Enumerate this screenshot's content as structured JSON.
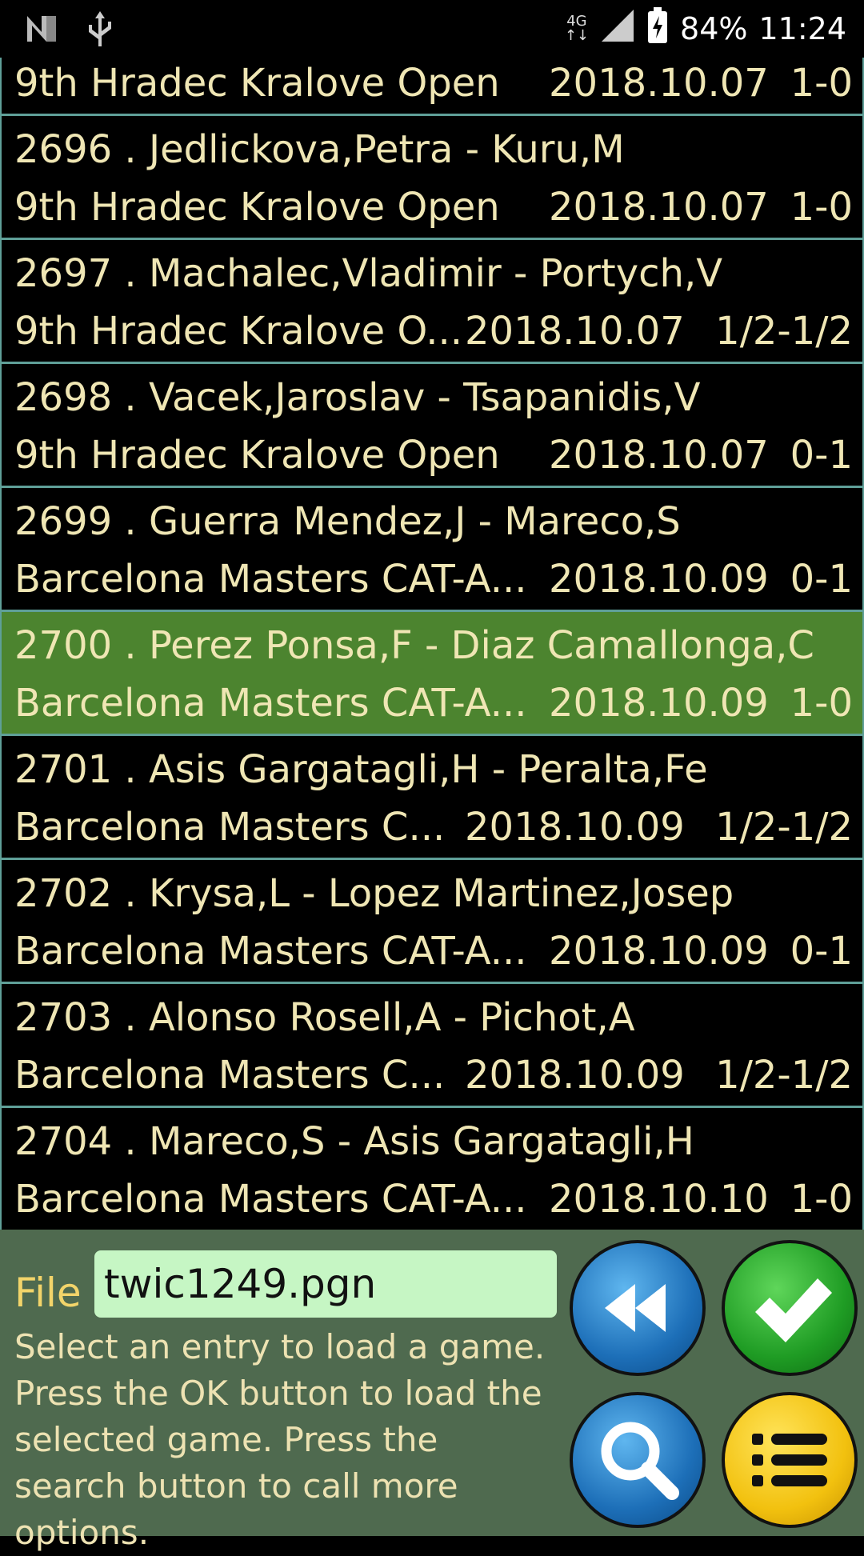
{
  "status_bar": {
    "network": "4G",
    "battery": "84%",
    "time": "11:24"
  },
  "games": [
    {
      "number": "",
      "white": "",
      "black": "",
      "event": "9th Hradec Kralove Open",
      "date": "2018.10.07",
      "result": "1-0"
    },
    {
      "number": "2696 .",
      "white": "Jedlickova,Petra",
      "black": "- Kuru,M",
      "event": "9th Hradec Kralove Open",
      "date": "2018.10.07",
      "result": "1-0"
    },
    {
      "number": "2697 .",
      "white": "Machalec,Vladimir",
      "black": "- Portych,V",
      "event": "9th Hradec Kralove O...",
      "date": "2018.10.07",
      "result": "1/2-1/2"
    },
    {
      "number": "2698 .",
      "white": "Vacek,Jaroslav",
      "black": "- Tsapanidis,V",
      "event": "9th Hradec Kralove Open",
      "date": "2018.10.07",
      "result": "0-1"
    },
    {
      "number": "2699 .",
      "white": "Guerra Mendez,J",
      "black": "- Mareco,S",
      "event": "Barcelona Masters CAT-A...",
      "date": "2018.10.09",
      "result": "0-1"
    },
    {
      "number": "2700 .",
      "white": "Perez Ponsa,F",
      "black": "- Diaz Camallonga,C",
      "event": "Barcelona Masters CAT-A...",
      "date": "2018.10.09",
      "result": "1-0"
    },
    {
      "number": "2701 .",
      "white": "Asis Gargatagli,H",
      "black": "- Peralta,Fe",
      "event": "Barcelona Masters C...",
      "date": "2018.10.09",
      "result": "1/2-1/2"
    },
    {
      "number": "2702 .",
      "white": "Krysa,L",
      "black": "- Lopez Martinez,Josep",
      "event": "Barcelona Masters CAT-A...",
      "date": "2018.10.09",
      "result": "0-1"
    },
    {
      "number": "2703 .",
      "white": "Alonso Rosell,A",
      "black": "- Pichot,A",
      "event": "Barcelona Masters C...",
      "date": "2018.10.09",
      "result": "1/2-1/2"
    },
    {
      "number": "2704 .",
      "white": "Mareco,S",
      "black": "- Asis Gargatagli,H",
      "event": "Barcelona Masters CAT-A...",
      "date": "2018.10.10",
      "result": "1-0"
    }
  ],
  "selected_game": "2700 .",
  "panel": {
    "file_label": "File",
    "file_value": "twic1249.pgn",
    "help_text": "Select an entry to load a game. Press the OK button to load the selected game. Press the search button to call more options."
  },
  "buttons": {
    "back_icon": "rewind-icon",
    "ok_icon": "checkmark-icon",
    "search_icon": "search-icon",
    "menu_icon": "menu-list-icon"
  },
  "colors": {
    "list_text": "#efe6b4",
    "selected_row": "#4c842f",
    "row_divider": "#5f9f98",
    "panel_bg": "#4f6a4f",
    "file_input_bg": "#c6f6c4"
  }
}
